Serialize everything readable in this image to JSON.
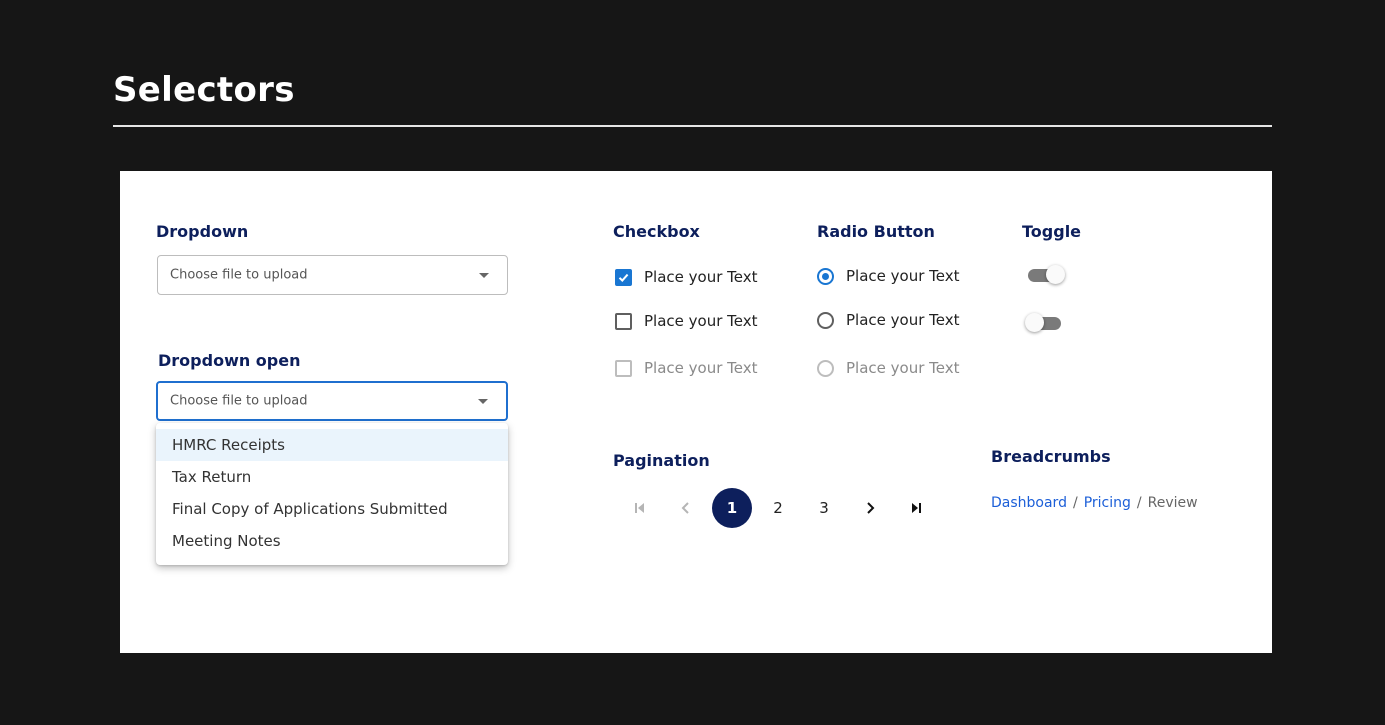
{
  "page": {
    "title": "Selectors"
  },
  "dropdown": {
    "label": "Dropdown",
    "placeholder": "Choose file to upload"
  },
  "dropdown_open": {
    "label": "Dropdown open",
    "placeholder": "Choose file to upload",
    "options": [
      "HMRC Receipts",
      "Tax Return",
      "Final Copy of Applications Submitted",
      "Meeting Notes"
    ],
    "highlighted_index": 0
  },
  "checkbox": {
    "label": "Checkbox",
    "items": [
      {
        "text": "Place your Text",
        "state": "checked"
      },
      {
        "text": "Place your Text",
        "state": "unchecked"
      },
      {
        "text": "Place your Text",
        "state": "disabled"
      }
    ]
  },
  "radio": {
    "label": "Radio Button",
    "items": [
      {
        "text": "Place your Text",
        "state": "selected"
      },
      {
        "text": "Place your Text",
        "state": "unselected"
      },
      {
        "text": "Place your Text",
        "state": "disabled"
      }
    ]
  },
  "toggle": {
    "label": "Toggle",
    "states": [
      "on",
      "off"
    ]
  },
  "pagination": {
    "label": "Pagination",
    "pages": [
      "1",
      "2",
      "3"
    ],
    "current": "1"
  },
  "breadcrumbs": {
    "label": "Breadcrumbs",
    "items": [
      "Dashboard",
      "Pricing",
      "Review"
    ],
    "separator": "/"
  },
  "colors": {
    "background": "#161616",
    "panel": "#ffffff",
    "heading": "#0d1f5c",
    "accent": "#1976d2",
    "link": "#1c5fd8"
  }
}
